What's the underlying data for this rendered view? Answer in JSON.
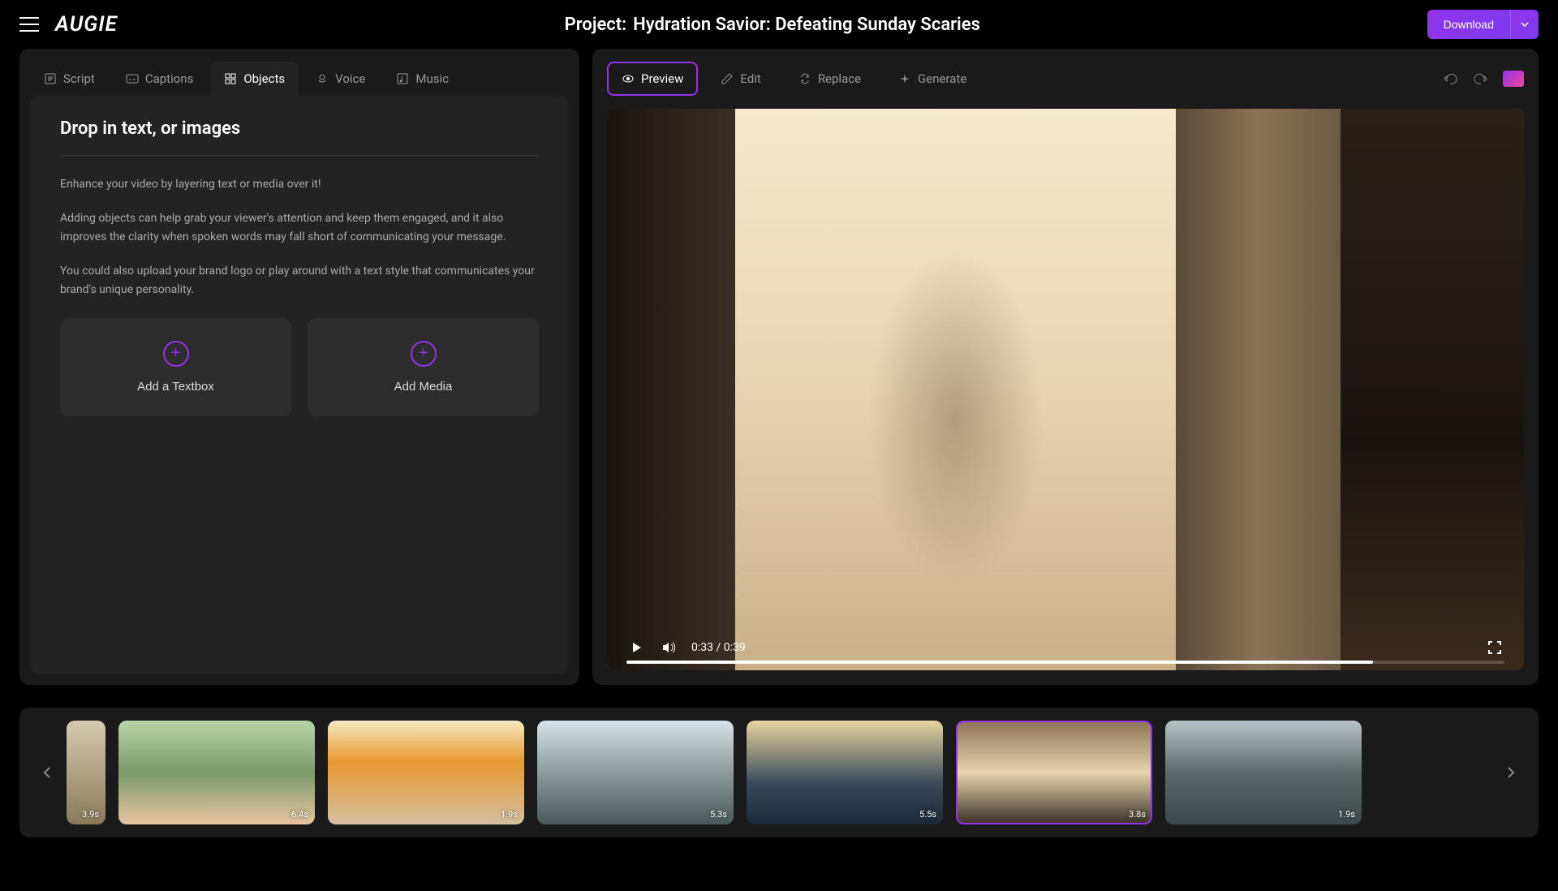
{
  "header": {
    "logo": "AUGIE",
    "project_label": "Project:",
    "project_title": "Hydration Savior: Defeating Sunday Scaries",
    "download_label": "Download"
  },
  "left_tabs": [
    {
      "label": "Script",
      "icon": "script-icon"
    },
    {
      "label": "Captions",
      "icon": "captions-icon"
    },
    {
      "label": "Objects",
      "icon": "objects-icon",
      "active": true
    },
    {
      "label": "Voice",
      "icon": "voice-icon"
    },
    {
      "label": "Music",
      "icon": "music-icon"
    }
  ],
  "objects_panel": {
    "heading": "Drop in text, or images",
    "para1": "Enhance your video by layering text or media over it!",
    "para2": "Adding objects can help grab your viewer's attention and keep them engaged, and it also improves the clarity when spoken words may fall short of communicating your message.",
    "para3": "You could also upload your brand logo or play around with a text style that communicates your brand's unique personality.",
    "add_textbox_label": "Add a Textbox",
    "add_media_label": "Add Media"
  },
  "right_tabs": [
    {
      "label": "Preview",
      "icon": "eye-icon",
      "active": true
    },
    {
      "label": "Edit",
      "icon": "pencil-icon"
    },
    {
      "label": "Replace",
      "icon": "replace-icon"
    },
    {
      "label": "Generate",
      "icon": "sparkle-icon"
    }
  ],
  "video": {
    "current_time": "0:33",
    "total_time": "0:39",
    "time_display": "0:33 / 0:39",
    "progress_percent": 85
  },
  "clips": [
    {
      "duration": "3.9s",
      "selected": false
    },
    {
      "duration": "6.4s",
      "selected": false
    },
    {
      "duration": "1.9s",
      "selected": false
    },
    {
      "duration": "5.3s",
      "selected": false
    },
    {
      "duration": "5.5s",
      "selected": false
    },
    {
      "duration": "3.8s",
      "selected": true
    },
    {
      "duration": "1.9s",
      "selected": false
    }
  ]
}
